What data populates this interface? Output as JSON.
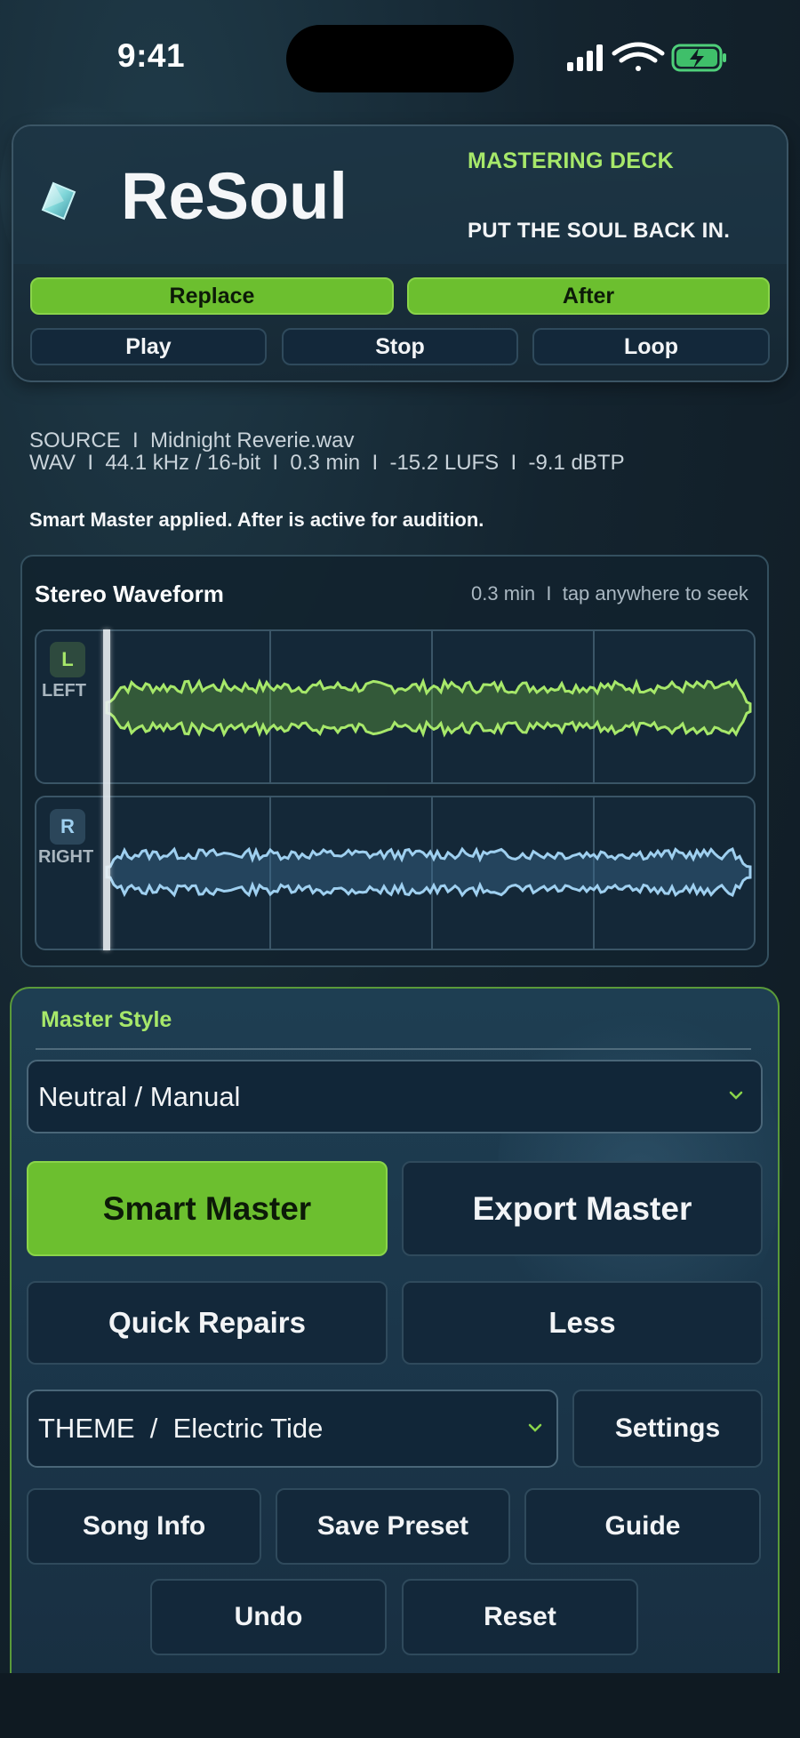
{
  "status_bar": {
    "time": "9:41",
    "icons": [
      "signal-icon",
      "wifi-icon",
      "battery-charging-icon"
    ]
  },
  "header": {
    "app_title": "ReSoul",
    "deck_label": "MASTERING DECK",
    "tagline": "PUT THE SOUL BACK IN.",
    "logo_icon": "gem-icon",
    "compare_buttons": {
      "replace": "Replace",
      "after": "After"
    },
    "transport": {
      "play": "Play",
      "stop": "Stop",
      "loop": "Loop"
    }
  },
  "source": {
    "line": "SOURCE  I  Midnight Reverie.wav",
    "meta": "WAV  I  44.1 kHz / 16-bit  I  0.3 min  I  -15.2 LUFS  I  -9.1 dBTP",
    "status": "Smart Master applied. After is active for audition."
  },
  "waveform": {
    "title": "Stereo Waveform",
    "hint": "0.3 min  I  tap anywhere to seek",
    "left": {
      "badge": "L",
      "label": "LEFT",
      "color": "#a7e86a"
    },
    "right": {
      "badge": "R",
      "label": "RIGHT",
      "color": "#9fd0f0"
    }
  },
  "master": {
    "title": "Master Style",
    "style_value": "Neutral / Manual",
    "smart_master": "Smart Master",
    "export_master": "Export Master",
    "quick_repairs": "Quick Repairs",
    "less": "Less",
    "theme_value": "THEME  /  Electric Tide",
    "settings": "Settings",
    "song_info": "Song Info",
    "save_preset": "Save Preset",
    "guide": "Guide",
    "undo": "Undo",
    "reset": "Reset"
  },
  "colors": {
    "accent_green": "#6cbf2f",
    "label_green": "#a7e86a",
    "right_channel": "#9fd0f0",
    "panel_dark": "#13283a"
  }
}
